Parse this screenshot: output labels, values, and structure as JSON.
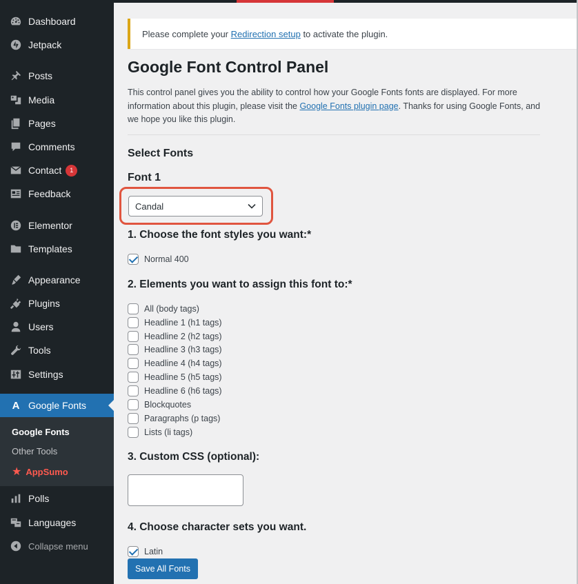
{
  "sidebar": {
    "items": [
      {
        "label": "Dashboard",
        "icon": "dashboard-icon"
      },
      {
        "label": "Jetpack",
        "icon": "jetpack-icon"
      },
      {
        "label": "Posts",
        "icon": "pin-icon"
      },
      {
        "label": "Media",
        "icon": "media-icon"
      },
      {
        "label": "Pages",
        "icon": "pages-icon"
      },
      {
        "label": "Comments",
        "icon": "comment-icon"
      },
      {
        "label": "Contact",
        "icon": "mail-icon",
        "badge": "1"
      },
      {
        "label": "Feedback",
        "icon": "feedback-icon"
      },
      {
        "label": "Elementor",
        "icon": "elementor-icon"
      },
      {
        "label": "Templates",
        "icon": "folder-icon"
      },
      {
        "label": "Appearance",
        "icon": "brush-icon"
      },
      {
        "label": "Plugins",
        "icon": "plugin-icon"
      },
      {
        "label": "Users",
        "icon": "user-icon"
      },
      {
        "label": "Tools",
        "icon": "wrench-icon"
      },
      {
        "label": "Settings",
        "icon": "settings-icon"
      },
      {
        "label": "Google Fonts",
        "icon": "font-icon",
        "active": true
      },
      {
        "label": "Polls",
        "icon": "bar-chart-icon"
      },
      {
        "label": "Languages",
        "icon": "translate-icon"
      },
      {
        "label": "Collapse menu",
        "icon": "collapse-icon"
      }
    ],
    "submenu": {
      "current": "Google Fonts",
      "other": "Other Tools",
      "appsumo": "AppSumo"
    }
  },
  "colors": {
    "sidebar_bg": "#1d2327",
    "active_bg": "#2271b1",
    "notice_accent": "#dba617",
    "highlight": "#e0553f",
    "badge": "#d63638",
    "appsumo": "#ff5a4f"
  },
  "notice": {
    "before": "Please complete your ",
    "link": "Redirection setup",
    "after": " to activate the plugin."
  },
  "page": {
    "title": "Google Font Control Panel",
    "intro_before": "This control panel gives you the ability to control how your Google Fonts fonts are displayed. For more information about this plugin, please visit the ",
    "intro_link": "Google Fonts plugin page",
    "intro_after": ". Thanks for using Google Fonts, and we hope you like this plugin.",
    "select_fonts": "Select Fonts",
    "font1": "Font 1",
    "font_select_value": "Candal",
    "step1": "1. Choose the font styles you want:*",
    "styles": [
      {
        "label": "Normal 400",
        "checked": true
      }
    ],
    "step2": "2. Elements you want to assign this font to:*",
    "elements": [
      {
        "label": "All (body tags)",
        "checked": false
      },
      {
        "label": "Headline 1 (h1 tags)",
        "checked": false
      },
      {
        "label": "Headline 2 (h2 tags)",
        "checked": false
      },
      {
        "label": "Headline 3 (h3 tags)",
        "checked": false
      },
      {
        "label": "Headline 4 (h4 tags)",
        "checked": false
      },
      {
        "label": "Headline 5 (h5 tags)",
        "checked": false
      },
      {
        "label": "Headline 6 (h6 tags)",
        "checked": false
      },
      {
        "label": "Blockquotes",
        "checked": false
      },
      {
        "label": "Paragraphs (p tags)",
        "checked": false
      },
      {
        "label": "Lists (li tags)",
        "checked": false
      }
    ],
    "step3": "3. Custom CSS (optional):",
    "custom_css": "",
    "step4": "4. Choose character sets you want.",
    "charsets": [
      {
        "label": "Latin",
        "checked": true
      }
    ],
    "save_label": "Save All Fonts"
  }
}
